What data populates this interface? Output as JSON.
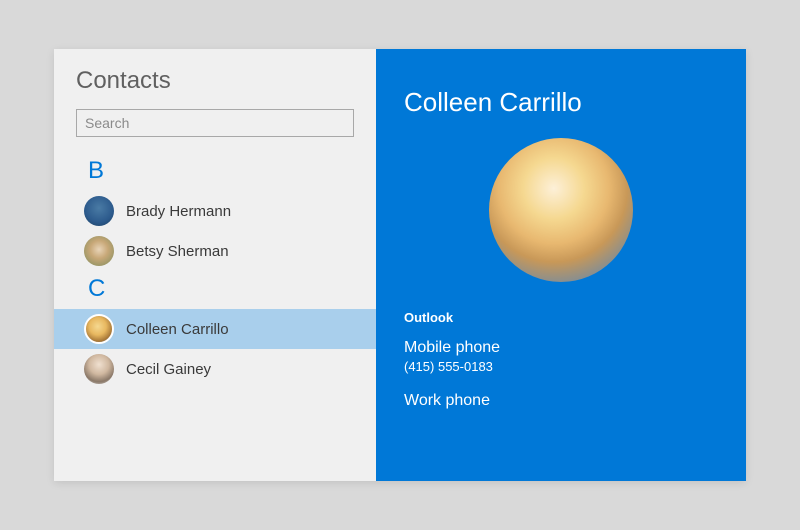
{
  "sidebar": {
    "title": "Contacts",
    "search_placeholder": "Search",
    "groups": [
      {
        "letter": "B",
        "contacts": [
          {
            "name": "Brady Hermann"
          },
          {
            "name": "Betsy Sherman"
          }
        ]
      },
      {
        "letter": "C",
        "contacts": [
          {
            "name": "Colleen Carrillo",
            "selected": true
          },
          {
            "name": "Cecil Gainey"
          }
        ]
      }
    ]
  },
  "detail": {
    "name": "Colleen Carrillo",
    "source": "Outlook",
    "fields": [
      {
        "label": "Mobile phone",
        "value": "(415) 555-0183"
      },
      {
        "label": "Work phone",
        "value": ""
      }
    ]
  }
}
